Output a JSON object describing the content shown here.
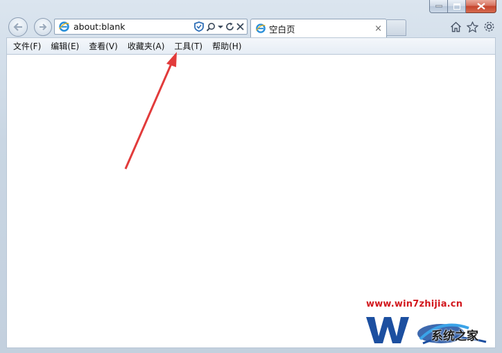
{
  "window": {
    "controls": {
      "minimize": "minimize",
      "maximize": "maximize",
      "close": "close"
    }
  },
  "nav": {
    "address_value": "about:blank"
  },
  "tabs": [
    {
      "title": "空白页",
      "close": "×"
    }
  ],
  "menu": {
    "items": [
      {
        "label": "文件(F)"
      },
      {
        "label": "编辑(E)"
      },
      {
        "label": "查看(V)"
      },
      {
        "label": "收藏夹(A)"
      },
      {
        "label": "工具(T)"
      },
      {
        "label": "帮助(H)"
      }
    ]
  },
  "watermark": {
    "url": "www.win7zhijia.cn",
    "site_name": "系统之家"
  },
  "colors": {
    "annotation_arrow": "#e23b3b",
    "watermark_red": "#d2171d",
    "watermark_blue": "#1c4fa0"
  },
  "icons": {
    "browser": "ie-icon",
    "back": "back-arrow-icon",
    "forward": "forward-arrow-icon",
    "home": "home-icon",
    "favorites": "star-icon",
    "tools": "gear-icon"
  }
}
